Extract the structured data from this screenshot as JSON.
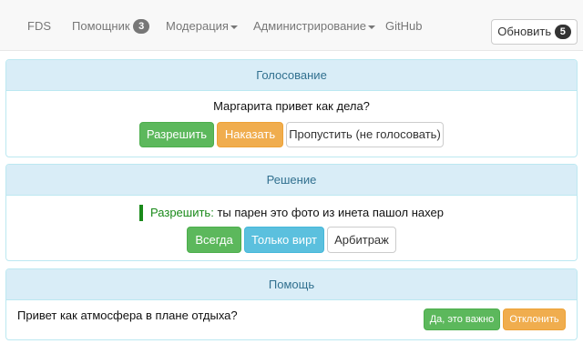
{
  "navbar": {
    "brand": "FDS",
    "helper_label": "Помощник",
    "helper_count": "3",
    "moderation_label": "Модерация",
    "administration_label": "Администрирование",
    "github_label": "GitHub",
    "refresh_label": "Обновить",
    "refresh_count": "5"
  },
  "voting": {
    "heading": "Голосование",
    "message": "Маргарита привет как дела?",
    "allow_label": "Разрешить",
    "punish_label": "Наказать",
    "skip_label": "Пропустить (не голосовать)"
  },
  "decision": {
    "heading": "Решение",
    "verdict_label": "Разрешить:",
    "verdict_text": " ты парен это фото из инета пашол нахер",
    "always_label": "Всегда",
    "virt_only_label": "Только вирт",
    "arbitration_label": "Арбитраж"
  },
  "help": {
    "heading": "Помощь",
    "question": "Привет как атмосфера в плане отдыха?",
    "important_label": "Да, это важно",
    "decline_label": "Отклонить"
  },
  "colors": {
    "success": "#5cb85c",
    "warning": "#f0ad4e",
    "info": "#5bc0de",
    "panel_heading_bg": "#d9edf7",
    "panel_heading_text": "#31708f"
  }
}
